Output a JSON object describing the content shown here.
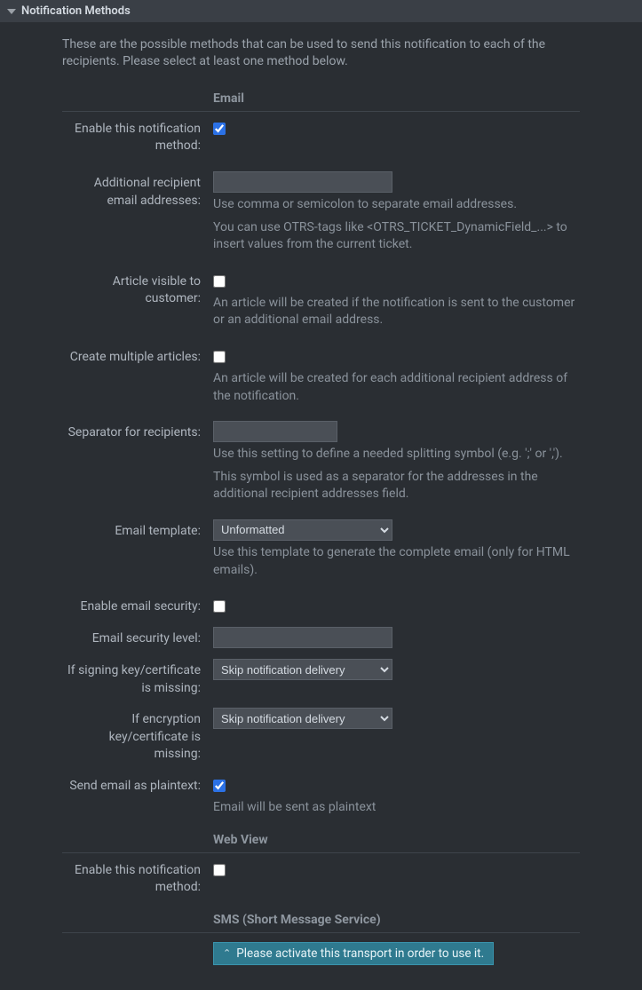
{
  "panel": {
    "title": "Notification Methods"
  },
  "intro": "These are the possible methods that can be used to send this notification to each of the recipients. Please select at least one method below.",
  "groups": {
    "email": {
      "heading": "Email",
      "enable": {
        "label": "Enable this notification method:",
        "checked": true
      },
      "additional": {
        "label": "Additional recipient email addresses:",
        "value": "",
        "help1": "Use comma or semicolon to separate email addresses.",
        "help2": "You can use OTRS-tags like <OTRS_TICKET_DynamicField_...> to insert values from the current ticket."
      },
      "visible": {
        "label": "Article visible to customer:",
        "checked": false,
        "help": "An article will be created if the notification is sent to the customer or an additional email address."
      },
      "multiple": {
        "label": "Create multiple articles:",
        "checked": false,
        "help": "An article will be created for each additional recipient address of the notification."
      },
      "separator": {
        "label": "Separator for recipients:",
        "value": "",
        "help1": "Use this setting to define a needed splitting symbol (e.g. ';' or ',').",
        "help2": "This symbol is used as a separator for the addresses in the additional recipient addresses field."
      },
      "template": {
        "label": "Email template:",
        "selected": "Unformatted",
        "help": "Use this template to generate the complete email (only for HTML emails)."
      },
      "security": {
        "label": "Enable email security:",
        "checked": false
      },
      "securityLevel": {
        "label": "Email security level:",
        "value": ""
      },
      "signingMissing": {
        "label": "If signing key/certificate is missing:",
        "selected": "Skip notification delivery"
      },
      "encryptionMissing": {
        "label": "If encryption key/certificate is missing:",
        "selected": "Skip notification delivery"
      },
      "plaintext": {
        "label": "Send email as plaintext:",
        "checked": true,
        "help": "Email will be sent as plaintext"
      }
    },
    "webview": {
      "heading": "Web View",
      "enable": {
        "label": "Enable this notification method:",
        "checked": false
      }
    },
    "sms": {
      "heading": "SMS (Short Message Service)",
      "banner": "Please activate this transport in order to use it."
    }
  }
}
